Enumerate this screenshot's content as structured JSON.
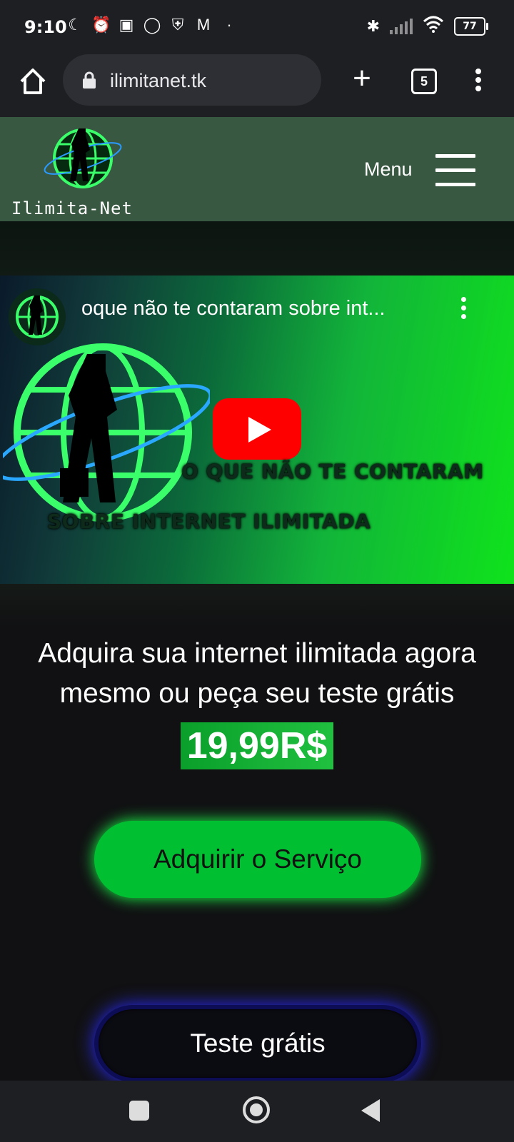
{
  "status": {
    "time": "9:10",
    "battery": "77",
    "icons_left": [
      "moon-icon",
      "alarm-icon",
      "nfc-icon",
      "whatsapp-icon",
      "shield-icon",
      "gmail-icon",
      "dot-icon"
    ],
    "icons_right": [
      "bluetooth-icon",
      "signal-icon",
      "wifi-icon",
      "battery-icon"
    ]
  },
  "browser": {
    "url": "ilimitanet.tk",
    "tab_count": "5"
  },
  "site": {
    "logo_text": "Ilimita-Net",
    "menu_label": "Menu"
  },
  "video": {
    "title": "oque não te contaram sobre int...",
    "overlay_line1": "O QUE NÃO TE CONTARAM",
    "overlay_line2": "SOBRE INTERNET ILIMITADA"
  },
  "main": {
    "headline": "Adquira sua internet ilimitada agora mesmo ou peça seu teste grátis",
    "price": "19,99R$",
    "buy_button": "Adquirir o Serviço",
    "trial_button": "Teste grátis"
  },
  "colors": {
    "header_bg": "#385841",
    "buy_button": "#00c032",
    "trial_glow": "#2a2aff",
    "page_bg": "#111113"
  }
}
